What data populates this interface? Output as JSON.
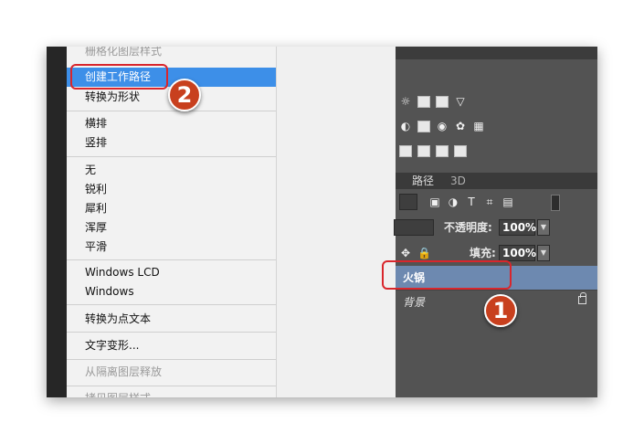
{
  "menu": {
    "items": [
      {
        "label": "栅格化图层样式",
        "state": "cut"
      },
      {
        "label": "创建工作路径",
        "state": "highlighted"
      },
      {
        "label": "转换为形状",
        "state": "normal"
      },
      {
        "label": "横排",
        "state": "normal"
      },
      {
        "label": "竖排",
        "state": "normal"
      },
      {
        "label": "无",
        "state": "normal"
      },
      {
        "label": "锐利",
        "state": "normal"
      },
      {
        "label": "犀利",
        "state": "normal"
      },
      {
        "label": "浑厚",
        "state": "normal"
      },
      {
        "label": "平滑",
        "state": "normal"
      },
      {
        "label": "Windows LCD",
        "state": "normal"
      },
      {
        "label": "Windows",
        "state": "normal"
      },
      {
        "label": "转换为点文本",
        "state": "normal"
      },
      {
        "label": "文字变形...",
        "state": "normal"
      },
      {
        "label": "从隔离图层释放",
        "state": "disabled"
      },
      {
        "label": "拷贝图层样式",
        "state": "cut"
      }
    ]
  },
  "panel": {
    "tabs": [
      {
        "label": "路径"
      },
      {
        "label": "3D"
      }
    ],
    "opacity_label": "不透明度:",
    "opacity_value": "100%",
    "fill_label": "填充:",
    "fill_value": "100%",
    "layers": [
      {
        "name": "火锅",
        "selected": true
      },
      {
        "name": "背景",
        "selected": false,
        "locked": true
      }
    ]
  },
  "annotations": {
    "step1": "1",
    "step2": "2",
    "color": "#d9262c",
    "badge_color": "#c8401e"
  },
  "colors": {
    "menu_highlight": "#3d8fe8",
    "layer_selected": "#6d89b0",
    "panel_bg": "#535353"
  }
}
